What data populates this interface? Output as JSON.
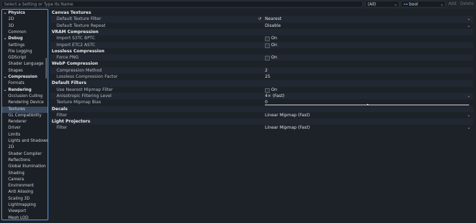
{
  "toolbar": {
    "search_placeholder": "Select a Setting or Type its Name",
    "filter_value": "(All)",
    "name_type_icon": "bool-type-icon",
    "name_value": "bool",
    "add_label": "Add",
    "delete_label": "Delete"
  },
  "sidebar": {
    "items": [
      {
        "label": "Physics",
        "level": 0
      },
      {
        "label": "2D",
        "level": 1
      },
      {
        "label": "3D",
        "level": 1
      },
      {
        "label": "Common",
        "level": 1
      },
      {
        "label": "Debug",
        "level": 0
      },
      {
        "label": "Settings",
        "level": 1
      },
      {
        "label": "File Logging",
        "level": 1
      },
      {
        "label": "GDScript",
        "level": 1
      },
      {
        "label": "Shader Language",
        "level": 1
      },
      {
        "label": "Shapes",
        "level": 1
      },
      {
        "label": "Compression",
        "level": 0
      },
      {
        "label": "Formats",
        "level": 1
      },
      {
        "label": "Rendering",
        "level": 0
      },
      {
        "label": "Occlusion Culling",
        "level": 1
      },
      {
        "label": "Rendering Device",
        "level": 1
      },
      {
        "label": "Textures",
        "level": 1,
        "selected": true
      },
      {
        "label": "GL Compatibility",
        "level": 1
      },
      {
        "label": "Renderer",
        "level": 1
      },
      {
        "label": "Driver",
        "level": 1
      },
      {
        "label": "Limits",
        "level": 1
      },
      {
        "label": "Lights and Shadows",
        "level": 1
      },
      {
        "label": "2D",
        "level": 1
      },
      {
        "label": "Shader Compiler",
        "level": 1
      },
      {
        "label": "Reflections",
        "level": 1
      },
      {
        "label": "Global Illumination",
        "level": 1
      },
      {
        "label": "Shading",
        "level": 1
      },
      {
        "label": "Camera",
        "level": 1
      },
      {
        "label": "Environment",
        "level": 1
      },
      {
        "label": "Anti Aliasing",
        "level": 1
      },
      {
        "label": "Scaling 3D",
        "level": 1
      },
      {
        "label": "Lightmapping",
        "level": 1
      },
      {
        "label": "Viewport",
        "level": 1
      },
      {
        "label": "Mesh LOD",
        "level": 1
      }
    ]
  },
  "inspector": {
    "rows": [
      {
        "kind": "section",
        "label": "Canvas Textures"
      },
      {
        "kind": "dropdown",
        "label": "Default Texture Filter",
        "value": "Nearest",
        "revert": true
      },
      {
        "kind": "dropdown",
        "label": "Default Texture Repeat",
        "value": "Disable"
      },
      {
        "kind": "section",
        "label": "VRAM Compression"
      },
      {
        "kind": "check",
        "label": "Import S3TC BPTC",
        "value": "On"
      },
      {
        "kind": "check",
        "label": "Import ETC2 ASTC",
        "value": "On"
      },
      {
        "kind": "section",
        "label": "Lossless Compression"
      },
      {
        "kind": "check",
        "label": "Force PNG",
        "value": "On"
      },
      {
        "kind": "section",
        "label": "WebP Compression"
      },
      {
        "kind": "number",
        "label": "Compression Method",
        "value": "2"
      },
      {
        "kind": "number",
        "label": "Lossless Compression Factor",
        "value": "25"
      },
      {
        "kind": "section",
        "label": "Default Filters"
      },
      {
        "kind": "check",
        "label": "Use Nearest Mipmap Filter",
        "value": "On"
      },
      {
        "kind": "dropdown",
        "label": "Anisotropic Filtering Level",
        "value": "4× (Fast)"
      },
      {
        "kind": "slider",
        "label": "Texture Mipmap Bias",
        "value": "0",
        "fraction": 0.5
      },
      {
        "kind": "section",
        "label": "Decals"
      },
      {
        "kind": "dropdown",
        "label": "Filter",
        "value": "Linear Mipmap (Fast)"
      },
      {
        "kind": "section",
        "label": "Light Projectors"
      },
      {
        "kind": "dropdown",
        "label": "Filter",
        "value": "Linear Mipmap (Fast)"
      }
    ]
  },
  "colors": {
    "accent": "#5aa0e6",
    "background": "#1d2229",
    "selected": "#3a4a5e"
  }
}
